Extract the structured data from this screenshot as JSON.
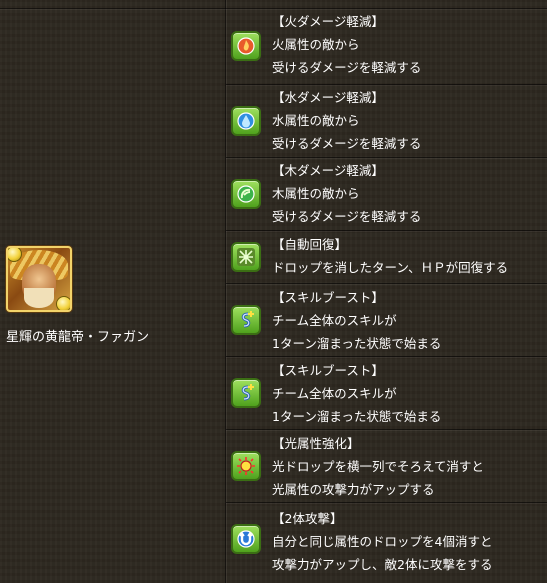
{
  "monster": {
    "name": "星輝の黄龍帝・ファガン"
  },
  "awakenings": [
    {
      "icon": "fire-reduction-icon",
      "title": "【火ダメージ軽減】",
      "lines": [
        "火属性の敵から",
        "受けるダメージを軽減する"
      ]
    },
    {
      "icon": "water-reduction-icon",
      "title": "【水ダメージ軽減】",
      "lines": [
        "水属性の敵から",
        "受けるダメージを軽減する"
      ]
    },
    {
      "icon": "wood-reduction-icon",
      "title": "【木ダメージ軽減】",
      "lines": [
        "木属性の敵から",
        "受けるダメージを軽減する"
      ]
    },
    {
      "icon": "auto-recover-icon",
      "title": "【自動回復】",
      "lines": [
        "ドロップを消したターン、ＨＰが回復する"
      ]
    },
    {
      "icon": "skill-boost-icon",
      "title": "【スキルブースト】",
      "lines": [
        "チーム全体のスキルが",
        "1ターン溜まった状態で始まる"
      ]
    },
    {
      "icon": "skill-boost-icon",
      "title": "【スキルブースト】",
      "lines": [
        "チーム全体のスキルが",
        "1ターン溜まった状態で始まる"
      ]
    },
    {
      "icon": "light-enhance-icon",
      "title": "【光属性強化】",
      "lines": [
        "光ドロップを横一列でそろえて消すと",
        "光属性の攻撃力がアップする"
      ]
    },
    {
      "icon": "two-pronged-attack-icon",
      "title": "【2体攻撃】",
      "lines": [
        "自分と同じ属性のドロップを4個消すと",
        "攻撃力がアップし、敵2体に攻撃をする"
      ]
    }
  ]
}
